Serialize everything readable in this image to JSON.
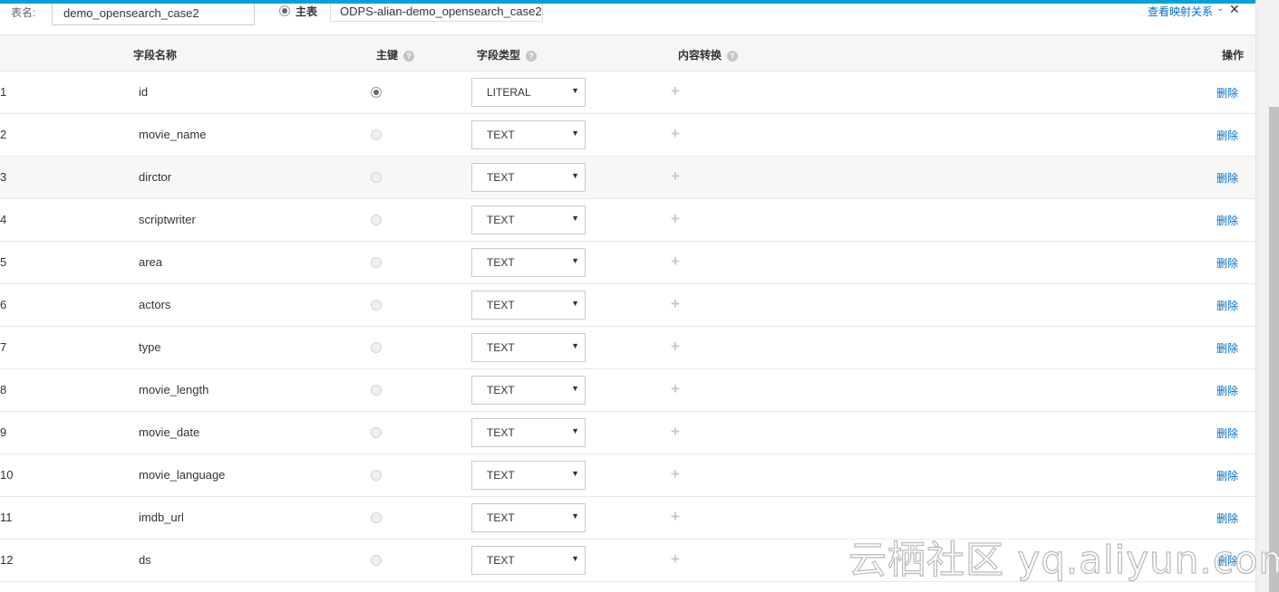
{
  "header": {
    "table_name_label": "表名:",
    "table_name_value": "demo_opensearch_case2",
    "main_table_label": "主表",
    "source_table": "ODPS-alian-demo_opensearch_case2",
    "mapping_link": "查看映射关系",
    "chevron_icon": "chevron-down-icon",
    "close_glyph": "✕"
  },
  "columns": {
    "field_name": "字段名称",
    "primary_key": "主键",
    "field_type": "字段类型",
    "content_conversion": "内容转换",
    "action": "操作",
    "help_glyph": "?"
  },
  "rows": [
    {
      "num": "1",
      "name": "id",
      "primary": true,
      "type": "LITERAL",
      "plus": "+",
      "action": "删除"
    },
    {
      "num": "2",
      "name": "movie_name",
      "primary": false,
      "type": "TEXT",
      "plus": "+",
      "action": "删除"
    },
    {
      "num": "3",
      "name": "dirctor",
      "primary": false,
      "type": "TEXT",
      "plus": "+",
      "action": "删除"
    },
    {
      "num": "4",
      "name": "scriptwriter",
      "primary": false,
      "type": "TEXT",
      "plus": "+",
      "action": "删除"
    },
    {
      "num": "5",
      "name": "area",
      "primary": false,
      "type": "TEXT",
      "plus": "+",
      "action": "删除"
    },
    {
      "num": "6",
      "name": "actors",
      "primary": false,
      "type": "TEXT",
      "plus": "+",
      "action": "删除"
    },
    {
      "num": "7",
      "name": "type",
      "primary": false,
      "type": "TEXT",
      "plus": "+",
      "action": "删除"
    },
    {
      "num": "8",
      "name": "movie_length",
      "primary": false,
      "type": "TEXT",
      "plus": "+",
      "action": "删除"
    },
    {
      "num": "9",
      "name": "movie_date",
      "primary": false,
      "type": "TEXT",
      "plus": "+",
      "action": "删除"
    },
    {
      "num": "10",
      "name": "movie_language",
      "primary": false,
      "type": "TEXT",
      "plus": "+",
      "action": "删除"
    },
    {
      "num": "11",
      "name": "imdb_url",
      "primary": false,
      "type": "TEXT",
      "plus": "+",
      "action": "删除"
    },
    {
      "num": "12",
      "name": "ds",
      "primary": false,
      "type": "TEXT",
      "plus": "+",
      "action": "删除"
    }
  ],
  "select_arrow": "▼",
  "watermark": "云栖社区 yq.aliyun.com",
  "colors": {
    "accent_bar": "#00a2d9",
    "link": "#0070cc",
    "header_bg": "#f5f6f7"
  }
}
